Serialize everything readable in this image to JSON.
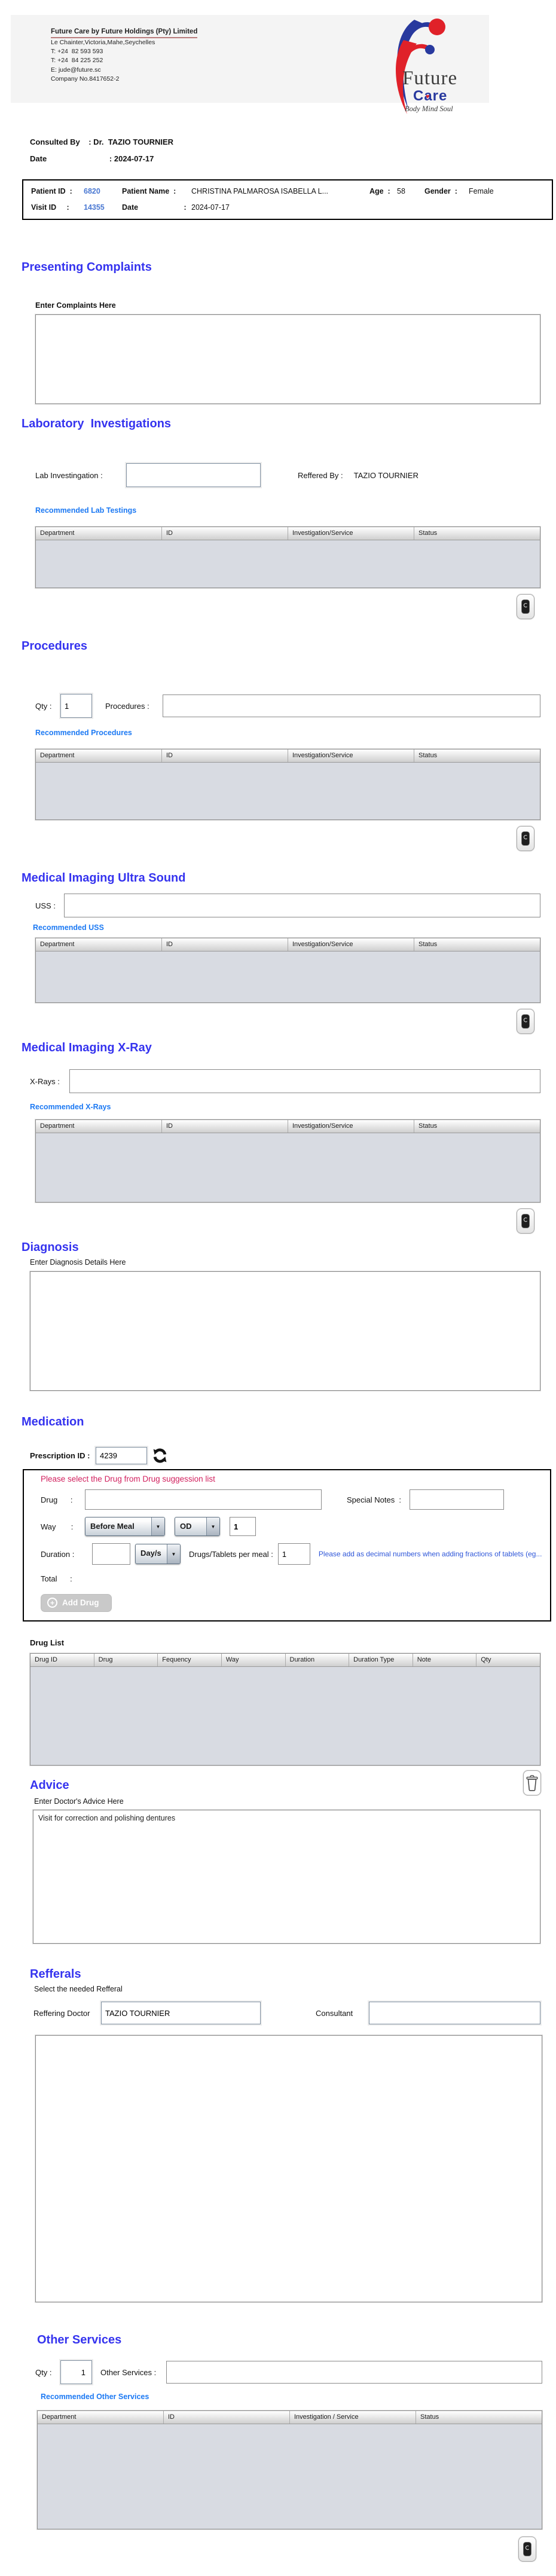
{
  "colors": {
    "heading_blue": "#3533ef",
    "link_blue": "#1c79f3",
    "warning_red": "#d2205e",
    "hint_blue": "#2d55d8",
    "id_blue": "#4a78d2",
    "logo_blue": "#28399e",
    "logo_red": "#e02129",
    "table_body": "#d8dbe2"
  },
  "letterhead": {
    "company_name": "Future Care by Future Holdings (Pty) Limited",
    "address": "Le Chainter,Victoria,Mahe,Seychelles",
    "phone1": "T: +24  82 593 593",
    "phone2": "T: +24  84 225 252",
    "email": "E: jude@future.sc",
    "company_no": "Company No.8417652-2",
    "logo": {
      "word1": "Future",
      "word2": "Care",
      "heart": "♥",
      "tagline": "Body Mind Soul"
    }
  },
  "consultation": {
    "consulted_by_label": "Consulted By    :",
    "consulted_by": " Dr.  TAZIO TOURNIER",
    "date_label": "Date                             :",
    "date": " 2024-07-17"
  },
  "patient": {
    "patient_id_label": "Patient ID  :",
    "patient_id": "6820",
    "patient_name_label": "Patient Name  :",
    "patient_name": "CHRISTINA PALMAROSA ISABELLA L...",
    "age_label": "Age  :",
    "age": "58",
    "gender_label": "Gender  :",
    "gender": "Female",
    "visit_id_label": "Visit ID     :",
    "visit_id": "14355",
    "visit_date_label": "Date                      :",
    "visit_date": "2024-07-17"
  },
  "presenting_complaints": {
    "title": "Presenting Complaints",
    "label": "Enter Complaints Here",
    "value": ""
  },
  "laboratory": {
    "title": "Laboratory  Investigations",
    "input_label": "Lab Investingation :",
    "input_value": "",
    "referred_by_label": "Reffered By :",
    "referred_by": "TAZIO TOURNIER",
    "recommended_label": "Recommended Lab Testings",
    "table": {
      "columns": [
        "Department",
        "ID",
        "Investigation/Service",
        "Status"
      ],
      "rows": []
    }
  },
  "procedures": {
    "title": "Procedures",
    "qty_label": "Qty :",
    "qty_value": "1",
    "input_label": "Procedures :",
    "input_value": "",
    "recommended_label": "Recommended Procedures",
    "table": {
      "columns": [
        "Department",
        "ID",
        "Investigation/Service",
        "Status"
      ],
      "rows": []
    }
  },
  "ultrasound": {
    "title": "Medical Imaging Ultra Sound",
    "input_label": "USS :",
    "input_value": "",
    "recommended_label": "Recommended USS",
    "table": {
      "columns": [
        "Department",
        "ID",
        "Investigation/Service",
        "Status"
      ],
      "rows": []
    }
  },
  "xray": {
    "title": "Medical Imaging X-Ray",
    "input_label": "X-Rays :",
    "input_value": "",
    "recommended_label": "Recommended X-Rays",
    "table": {
      "columns": [
        "Department",
        "ID",
        "Investigation/Service",
        "Status"
      ],
      "rows": []
    }
  },
  "diagnosis": {
    "title": "Diagnosis",
    "label": "Enter Diagnosis Details Here",
    "value": ""
  },
  "medication": {
    "title": "Medication",
    "prescription_id_label": "Prescription ID :",
    "prescription_id": "4239",
    "warning": "Please select the Drug from Drug suggession list",
    "drug_label": "Drug      :",
    "drug_value": "",
    "special_notes_label": "Special Notes  :",
    "special_notes_value": "",
    "way_label": "Way       :",
    "meal_select": "Before Meal",
    "frequency_select": "OD",
    "frequency_qty": "1",
    "duration_label": "Duration :",
    "duration_value": "",
    "duration_unit": "Day/s",
    "per_meal_label": "Drugs/Tablets per meal :",
    "per_meal_value": "1",
    "fraction_hint": "Please add as decimal numbers when adding fractions of tablets (eg...",
    "total_label": "Total      :",
    "add_drug_button": "Add Drug",
    "plus_glyph": "+",
    "drug_list_label": "Drug List",
    "drug_table": {
      "columns": [
        "Drug ID",
        "Drug",
        "Fequency",
        "Way",
        "Duration",
        "Duration Type",
        "Note",
        "Qty"
      ],
      "rows": []
    }
  },
  "advice": {
    "title": "Advice",
    "label": "Enter Doctor's Advice Here",
    "value": "Visit for correction and polishing dentures"
  },
  "referrals": {
    "title": "Refferals",
    "subtitle": "Select the needed Refferal",
    "referring_doctor_label": "Reffering Doctor",
    "referring_doctor": "TAZIO TOURNIER",
    "consultant_label": "Consultant",
    "consultant": ""
  },
  "other_services": {
    "title": "Other Services",
    "qty_label": "Qty :",
    "qty_value": "1",
    "input_label": "Other Services :",
    "input_value": "",
    "recommended_label": "Recommended Other Services",
    "table": {
      "columns": [
        "Department",
        "ID",
        "Investigation / Service",
        "Status"
      ],
      "rows": []
    }
  },
  "dropdown_arrow": "▼"
}
